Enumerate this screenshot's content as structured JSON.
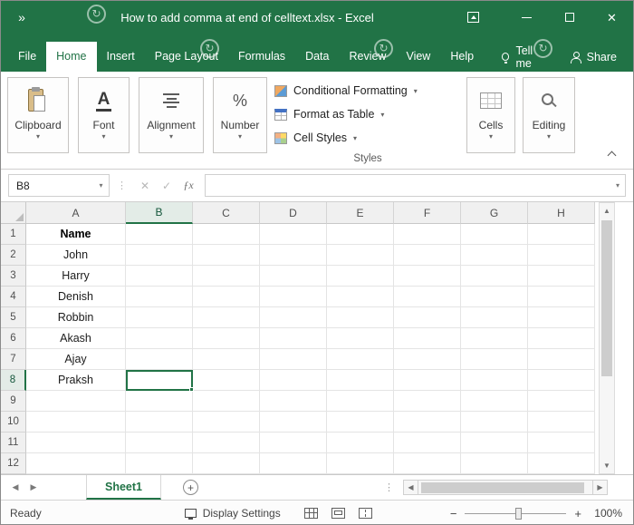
{
  "titlebar": {
    "quick_access": "»",
    "title": "How to add comma at end of celltext.xlsx - Excel"
  },
  "tabs": {
    "items": [
      "File",
      "Home",
      "Insert",
      "Page Layout",
      "Formulas",
      "Data",
      "Review",
      "View",
      "Help"
    ],
    "active": "Home",
    "tell_me_label": "Tell me",
    "share_label": "Share"
  },
  "ribbon": {
    "groups": [
      {
        "label": "Clipboard"
      },
      {
        "label": "Font"
      },
      {
        "label": "Alignment"
      },
      {
        "label": "Number"
      },
      {
        "label": "Cells"
      },
      {
        "label": "Editing"
      }
    ],
    "styles_group": {
      "buttons": [
        "Conditional Formatting",
        "Format as Table",
        "Cell Styles"
      ],
      "label": "Styles"
    },
    "font_glyph": "A",
    "number_glyph": "%"
  },
  "formula_bar": {
    "name_box_value": "B8",
    "cancel_glyph": "✕",
    "enter_glyph": "✓",
    "fx_glyph": "ƒx",
    "formula_value": ""
  },
  "grid": {
    "column_headers": [
      "A",
      "B",
      "C",
      "D",
      "E",
      "F",
      "G",
      "H"
    ],
    "visible_rows": 12,
    "active_cell": "B8",
    "column_a_values": [
      "Name",
      "John",
      "Harry",
      "Denish",
      "Robbin",
      "Akash",
      "Ajay",
      "Praksh"
    ]
  },
  "sheet_bar": {
    "sheet_name": "Sheet1"
  },
  "status_bar": {
    "status": "Ready",
    "display_settings": "Display Settings",
    "zoom_level": "100%"
  },
  "glyphs": {
    "caret": "▾",
    "up": "▲",
    "down": "▼",
    "left": "◀",
    "right": "▶",
    "close": "✕",
    "dots": "⋮",
    "plus": "+",
    "minus": "−",
    "watermark": "↻"
  },
  "colors": {
    "accent": "#217346",
    "active_cell_border": "#217346"
  }
}
